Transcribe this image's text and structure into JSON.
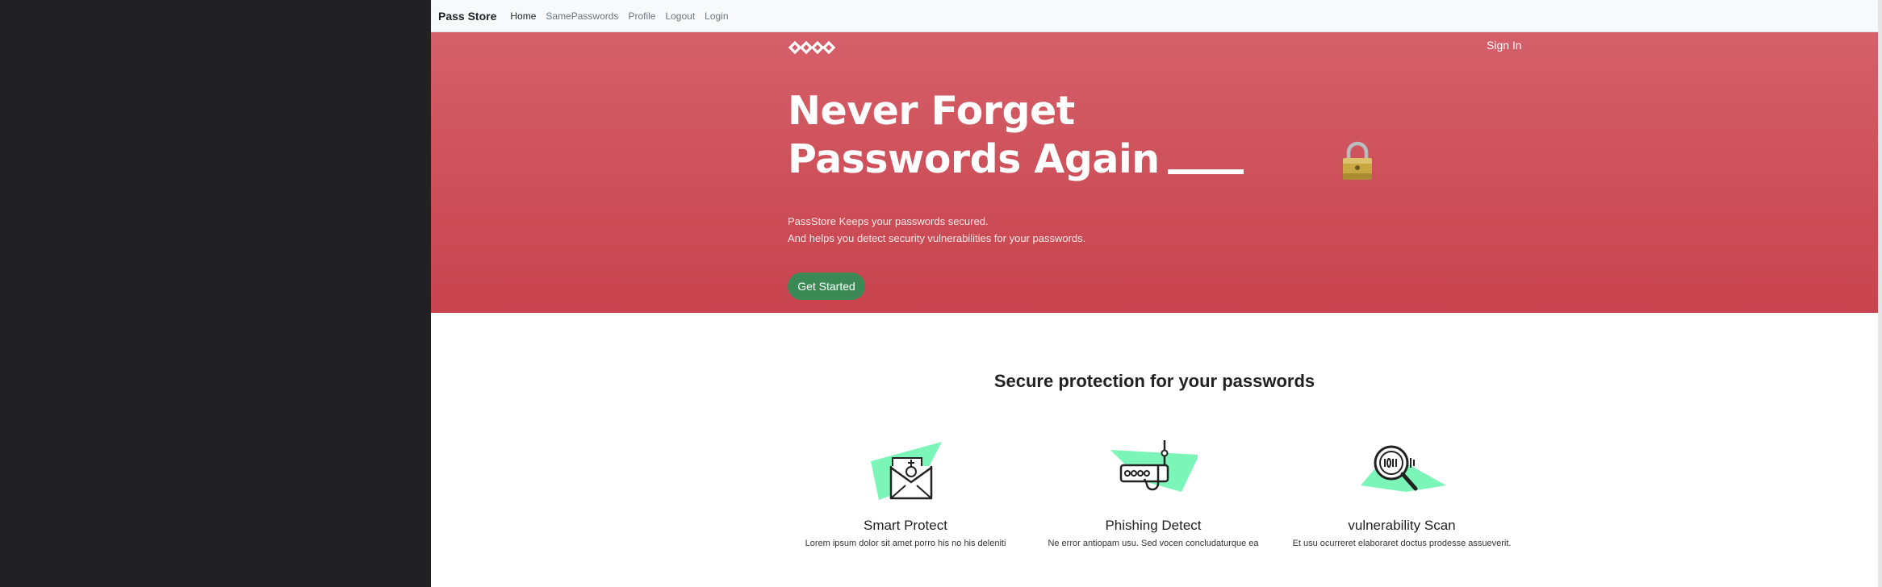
{
  "navbar": {
    "brand": "Pass Store",
    "links": [
      "Home",
      "SamePasswords",
      "Profile",
      "Logout",
      "Login"
    ],
    "active": "Home"
  },
  "hero": {
    "sign_in": "Sign In",
    "headline_line1": "Never Forget",
    "headline_line2": "Passwords Again",
    "sub_line1": "PassStore Keeps your passwords secured.",
    "sub_line2": "And helps you detect security vulnerabilities for your passwords.",
    "cta": "Get Started",
    "bg_color": "#cd4f59",
    "cta_color": "#3b8a55"
  },
  "features": {
    "title": "Secure protection for your passwords",
    "items": [
      {
        "title": "Smart Protect",
        "desc": "Lorem ipsum dolor sit amet porro his no his deleniti",
        "icon": "envelope-lock-icon"
      },
      {
        "title": "Phishing Detect",
        "desc": "Ne error antiopam usu. Sed vocen concludaturque ea",
        "icon": "phishing-hook-icon"
      },
      {
        "title": "vulnerability Scan",
        "desc": "Et usu ocurreret elaboraret doctus prodesse assueverit.",
        "icon": "magnifier-binary-icon"
      }
    ],
    "accent": "#7cf5b9"
  }
}
